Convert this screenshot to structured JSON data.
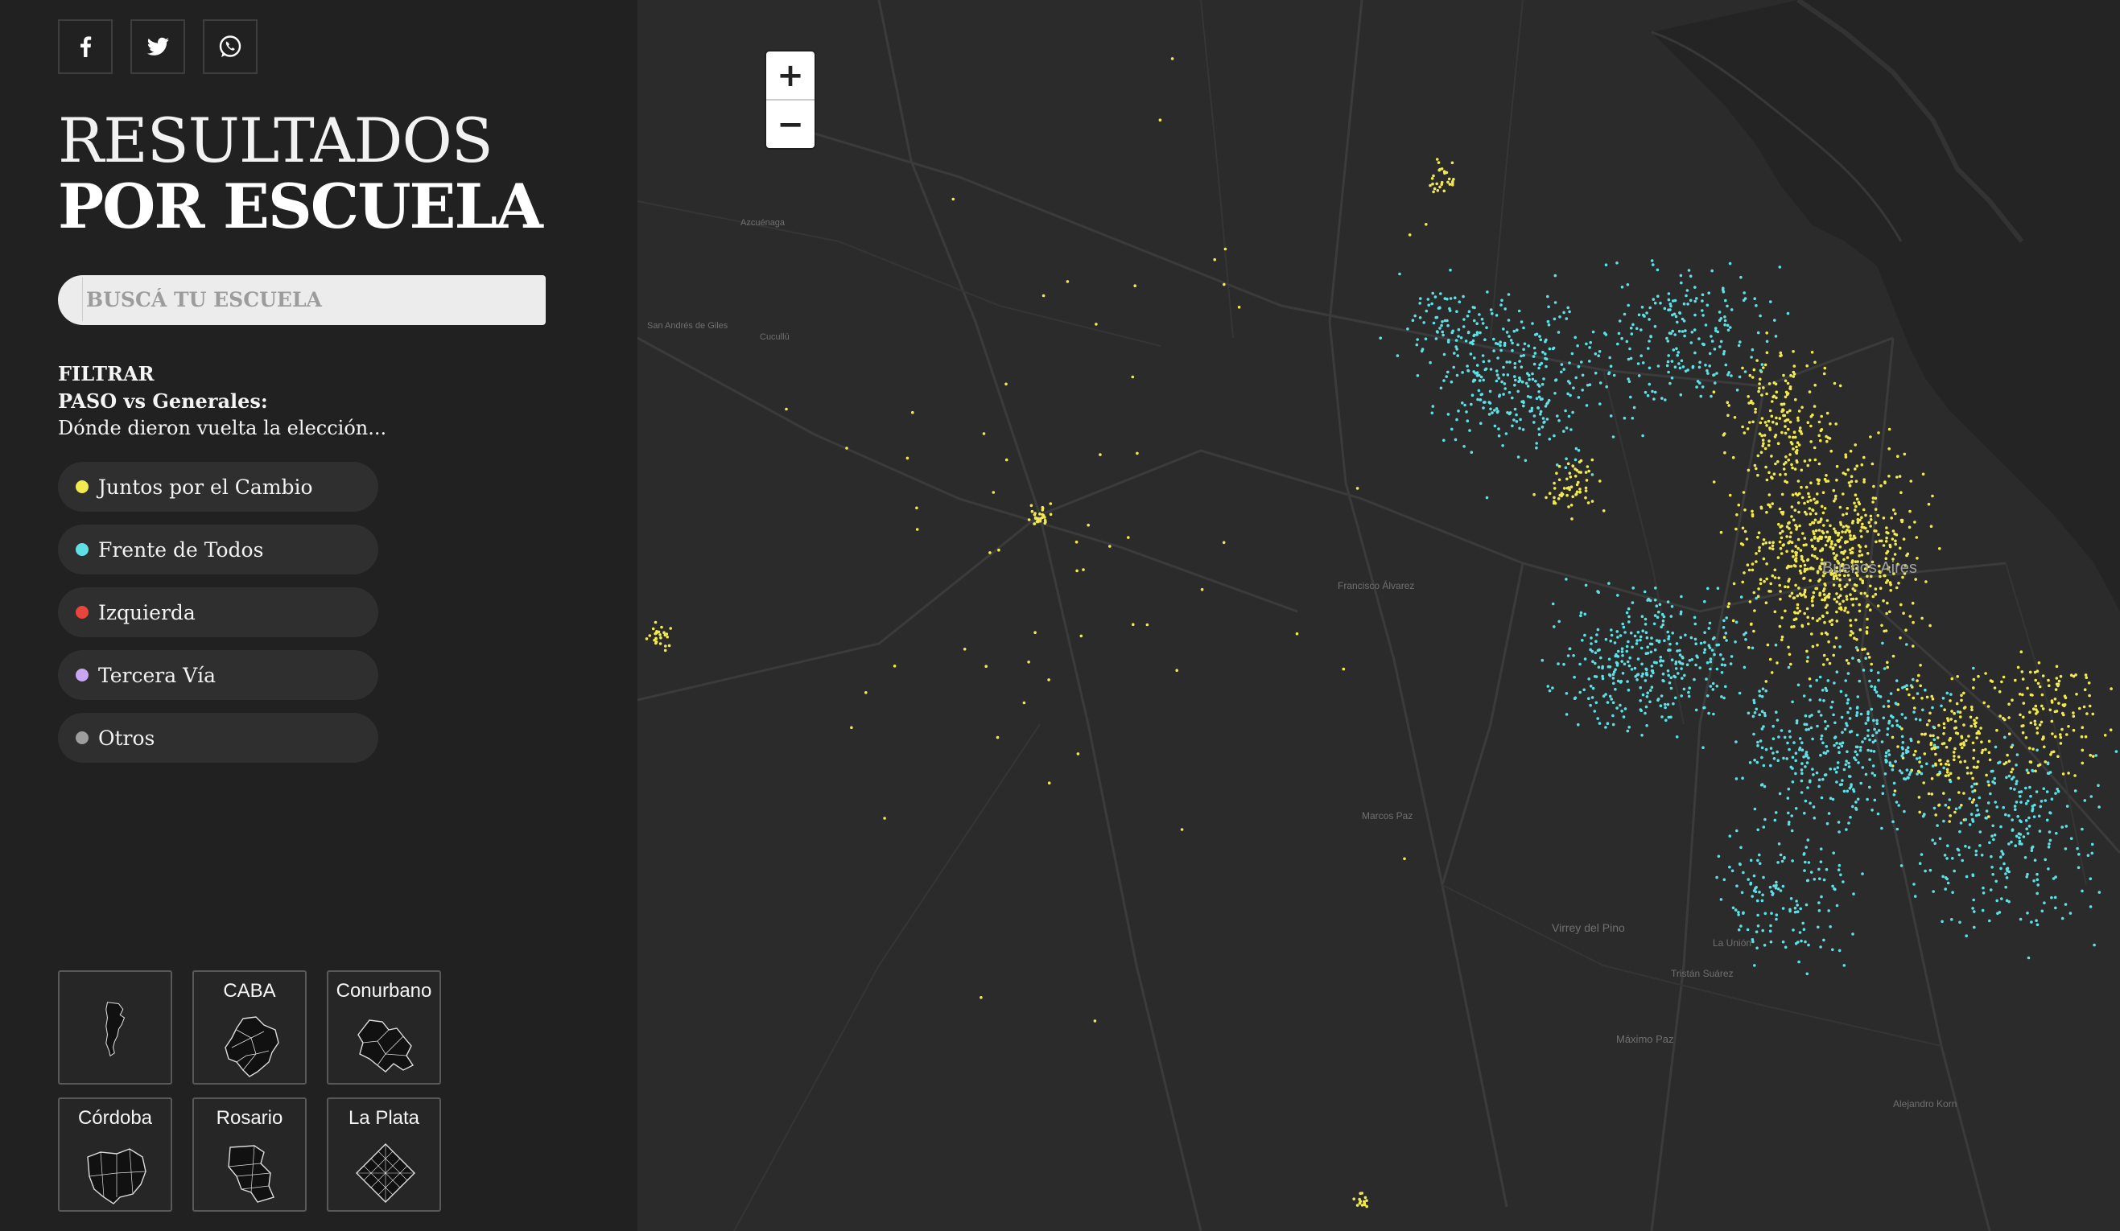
{
  "share": [
    {
      "name": "facebook",
      "icon": "facebook-icon",
      "glyph": "f"
    },
    {
      "name": "twitter",
      "icon": "twitter-icon"
    },
    {
      "name": "whatsapp",
      "icon": "whatsapp-icon"
    }
  ],
  "header": {
    "title_light": "RESULTADOS",
    "title_bold": "POR ESCUELA"
  },
  "search": {
    "placeholder": "BUSCÁ TU ESCUELA",
    "value": ""
  },
  "filter": {
    "heading": "FILTRAR",
    "subheading": "PASO vs Generales:",
    "description": "Dónde dieron vuelta la elección...",
    "items": [
      {
        "label": "Juntos por el Cambio",
        "color": "#f2e94e"
      },
      {
        "label": "Frente de Todos",
        "color": "#5ee0e6"
      },
      {
        "label": "Izquierda",
        "color": "#e8453c"
      },
      {
        "label": "Tercera Vía",
        "color": "#c9a6f2"
      },
      {
        "label": "Otros",
        "color": "#9e9e9e"
      }
    ]
  },
  "regions": [
    {
      "label": "",
      "icon": "argentina-map-icon"
    },
    {
      "label": "CABA",
      "icon": "caba-map-icon"
    },
    {
      "label": "Conurbano",
      "icon": "conurbano-map-icon"
    },
    {
      "label": "Córdoba",
      "icon": "cordoba-map-icon"
    },
    {
      "label": "Rosario",
      "icon": "rosario-map-icon"
    },
    {
      "label": "La Plata",
      "icon": "la-plata-map-icon"
    }
  ],
  "zoom": {
    "in": "+",
    "out": "−"
  },
  "map_labels": {
    "buenos_aires": "Buenos Aires",
    "virrey_del_pino": "Virrey del Pino",
    "maximo_paz": "Máximo Paz",
    "azcuenaga": "Azcuénaga",
    "cucullu": "Cucullú",
    "san_andres": "San Andrés de Giles",
    "francisco_alvarez": "Francisco Álvarez",
    "marcos_paz": "Marcos Paz",
    "alejandro_korn": "Alejandro Korn",
    "la_union": "La Unión",
    "tristan_suarez": "Tristán Suárez"
  }
}
